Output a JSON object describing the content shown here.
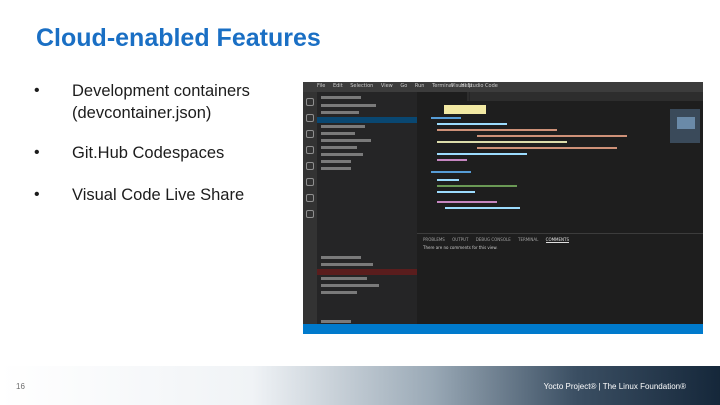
{
  "slide": {
    "title": "Cloud-enabled Features",
    "page_number": "16",
    "footer": "Yocto Project® | The Linux Foundation®"
  },
  "bullets": [
    {
      "marker": "•",
      "line1": "Development containers",
      "line2": "(devcontainer.json)"
    },
    {
      "marker": "•",
      "line1": "Git.Hub Codespaces"
    },
    {
      "marker": "•",
      "line1": "Visual Code Live Share"
    }
  ],
  "vscode": {
    "menu": [
      "File",
      "Edit",
      "Selection",
      "View",
      "Go",
      "Run",
      "Terminal",
      "Help"
    ],
    "window_title": "Visual Studio Code",
    "panel_tabs": [
      "PROBLEMS",
      "OUTPUT",
      "DEBUG CONSOLE",
      "TERMINAL",
      "COMMENTS"
    ],
    "panel_message": "There are no comments for this view.",
    "colors": {
      "editor_bg": "#1e1e1e",
      "sidebar_bg": "#252526",
      "activity_bg": "#333333",
      "status_bar": "#007acc"
    }
  },
  "colors": {
    "title": "#1a6fc4",
    "text": "#1c1c1c"
  }
}
